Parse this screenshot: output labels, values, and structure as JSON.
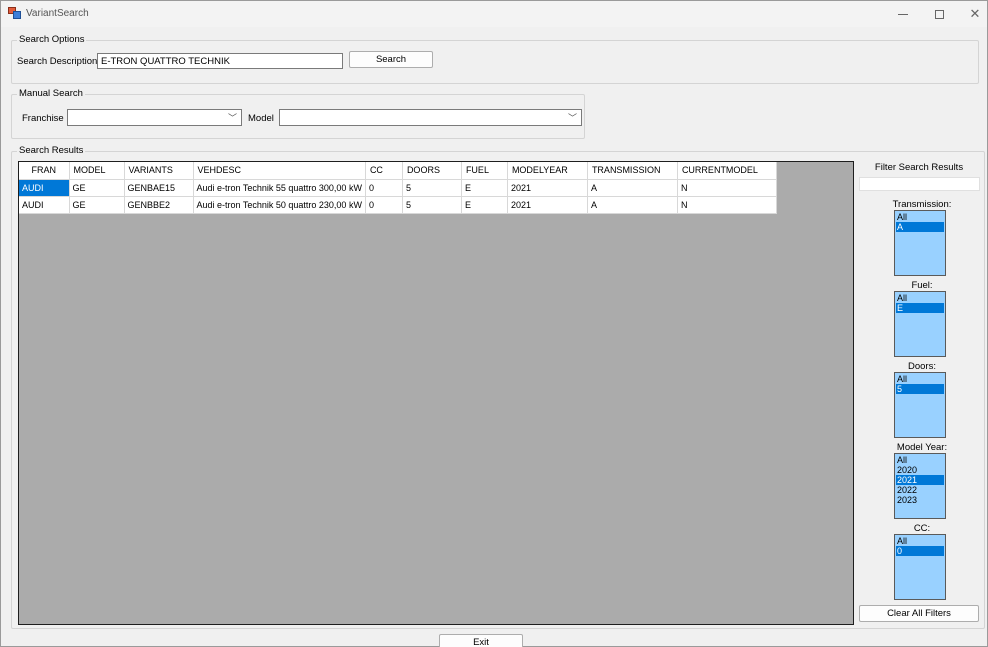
{
  "window": {
    "title": "VariantSearch",
    "minimize": "—",
    "maximize": "☐",
    "close": "✕"
  },
  "search_options": {
    "group_label": "Search Options",
    "description_label": "Search Description",
    "description_value": "E-TRON QUATTRO TECHNIK",
    "search_button": "Search"
  },
  "manual_search": {
    "group_label": "Manual Search",
    "franchise_label": "Franchise",
    "franchise_value": "",
    "model_label": "Model",
    "model_value": ""
  },
  "results": {
    "group_label": "Search Results",
    "columns": [
      "FRAN",
      "MODEL",
      "VARIANTS",
      "VEHDESC",
      "CC",
      "DOORS",
      "FUEL",
      "MODELYEAR",
      "TRANSMISSION",
      "CURRENTMODEL"
    ],
    "rows": [
      [
        "AUDI",
        "GE",
        "GENBAE15",
        "Audi e-tron  Technik 55 quattro 300,00 kW",
        "0",
        "5",
        "E",
        "2021",
        "A",
        "N"
      ],
      [
        "AUDI",
        "GE",
        "GENBBE2",
        "Audi e-tron  Technik 50 quattro 230,00 kW",
        "0",
        "5",
        "E",
        "2021",
        "A",
        "N"
      ]
    ]
  },
  "filters": {
    "title": "Filter Search Results",
    "filter_text": "",
    "transmission": {
      "label": "Transmission:",
      "options": [
        "All",
        "A"
      ],
      "selected": "A"
    },
    "fuel": {
      "label": "Fuel:",
      "options": [
        "All",
        "E"
      ],
      "selected": "E"
    },
    "doors": {
      "label": "Doors:",
      "options": [
        "All",
        "5"
      ],
      "selected": "5"
    },
    "model_year": {
      "label": "Model Year:",
      "options": [
        "All",
        "2020",
        "2021",
        "2022",
        "2023"
      ],
      "selected": "2021"
    },
    "cc": {
      "label": "CC:",
      "options": [
        "All",
        "0"
      ],
      "selected": "0"
    },
    "clear_button": "Clear All Filters"
  },
  "exit_button": "Exit",
  "colors": {
    "selection": "#0078d7",
    "listbox_bg": "#99d1ff",
    "grid_bg": "#ababab"
  },
  "icons": {
    "app": "app-icon",
    "dropdown": "chevron-down-icon"
  }
}
